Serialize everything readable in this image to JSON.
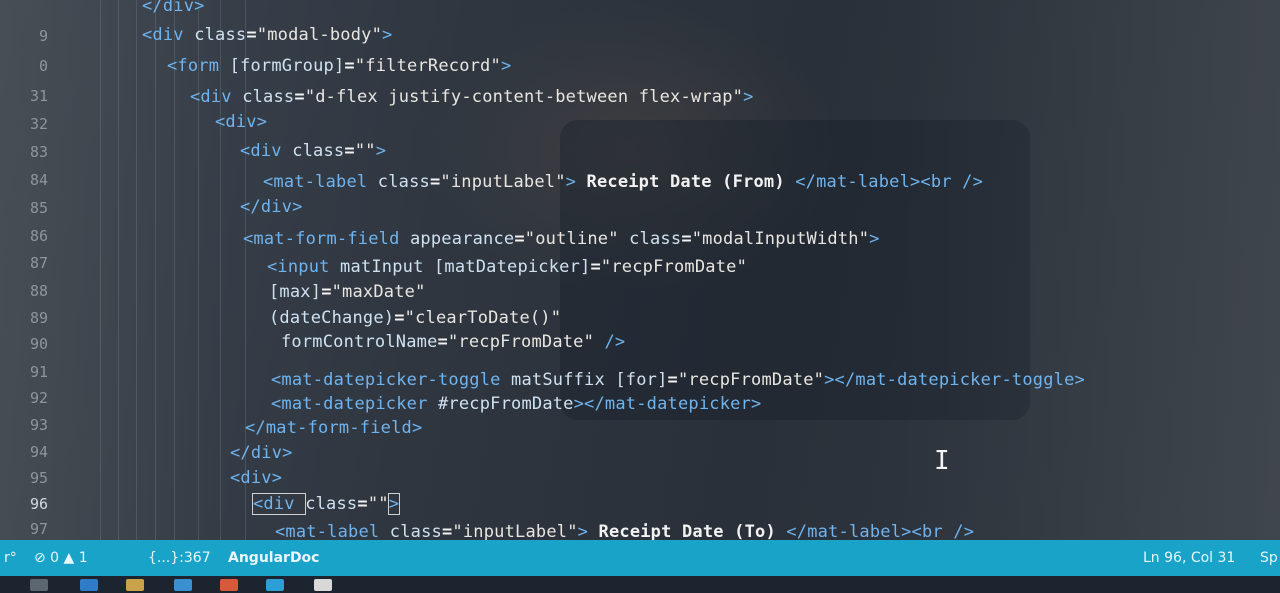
{
  "editor": {
    "lines": [
      {
        "num": "",
        "segs": [
          [
            "t",
            "</div>"
          ]
        ]
      },
      {
        "num": "9",
        "segs": [
          [
            "t",
            "<div "
          ],
          [
            "a",
            "class"
          ],
          [
            "x",
            "="
          ],
          [
            "s",
            "\"modal-body\""
          ],
          [
            "t",
            ">"
          ]
        ]
      },
      {
        "num": "0",
        "segs": [
          [
            "t",
            "<form "
          ],
          [
            "a",
            "[formGroup]"
          ],
          [
            "x",
            "="
          ],
          [
            "s",
            "\"filterRecord\""
          ],
          [
            "t",
            ">"
          ]
        ]
      },
      {
        "num": "31",
        "segs": [
          [
            "t",
            "<div "
          ],
          [
            "a",
            "class"
          ],
          [
            "x",
            "="
          ],
          [
            "s",
            "\"d-flex justify-content-between flex-wrap\""
          ],
          [
            "t",
            ">"
          ]
        ]
      },
      {
        "num": "32",
        "segs": [
          [
            "t",
            "<div>"
          ]
        ]
      },
      {
        "num": "83",
        "segs": [
          [
            "t",
            "<div "
          ],
          [
            "a",
            "class"
          ],
          [
            "x",
            "="
          ],
          [
            "s",
            "\"\""
          ],
          [
            "t",
            ">"
          ]
        ]
      },
      {
        "num": "84",
        "segs": [
          [
            "t",
            "<mat-label "
          ],
          [
            "a",
            "class"
          ],
          [
            "x",
            "="
          ],
          [
            "s",
            "\"inputLabel\""
          ],
          [
            "t",
            ">"
          ],
          [
            "x",
            " Receipt Date (From) "
          ],
          [
            "t",
            "</mat-label><br />"
          ]
        ]
      },
      {
        "num": "85",
        "segs": [
          [
            "t",
            "</div>"
          ]
        ]
      },
      {
        "num": "86",
        "segs": [
          [
            "t",
            "<mat-form-field "
          ],
          [
            "a",
            "appearance"
          ],
          [
            "x",
            "="
          ],
          [
            "s",
            "\"outline\" "
          ],
          [
            "a",
            "class"
          ],
          [
            "x",
            "="
          ],
          [
            "s",
            "\"modalInputWidth\""
          ],
          [
            "t",
            ">"
          ]
        ]
      },
      {
        "num": "87",
        "segs": [
          [
            "t",
            "<input "
          ],
          [
            "a",
            "matInput [matDatepicker]"
          ],
          [
            "x",
            "="
          ],
          [
            "s",
            "\"recpFromDate\""
          ]
        ]
      },
      {
        "num": "88",
        "segs": [
          [
            "a",
            "[max]"
          ],
          [
            "x",
            "="
          ],
          [
            "s",
            "\"maxDate\""
          ]
        ]
      },
      {
        "num": "89",
        "segs": [
          [
            "a",
            "(dateChange)"
          ],
          [
            "x",
            "="
          ],
          [
            "s",
            "\"clearToDate()\""
          ]
        ]
      },
      {
        "num": "90",
        "segs": [
          [
            "a",
            "formControlName"
          ],
          [
            "x",
            "="
          ],
          [
            "s",
            "\"recpFromDate\" "
          ],
          [
            "t",
            "/>"
          ]
        ]
      },
      {
        "num": "91",
        "segs": [
          [
            "t",
            "<mat-datepicker-toggle "
          ],
          [
            "a",
            "matSuffix [for]"
          ],
          [
            "x",
            "="
          ],
          [
            "s",
            "\"recpFromDate\""
          ],
          [
            "t",
            "></mat-datepicker-toggle>"
          ]
        ]
      },
      {
        "num": "92",
        "segs": [
          [
            "t",
            "<mat-datepicker "
          ],
          [
            "a",
            "#recpFromDate"
          ],
          [
            "t",
            "></mat-datepicker>"
          ]
        ]
      },
      {
        "num": "93",
        "segs": [
          [
            "t",
            "</mat-form-field>"
          ]
        ]
      },
      {
        "num": "94",
        "segs": [
          [
            "t",
            "</div>"
          ]
        ]
      },
      {
        "num": "95",
        "segs": [
          [
            "t",
            "<div>"
          ]
        ]
      },
      {
        "num": "96",
        "segs": [
          [
            "t",
            "<div "
          ],
          [
            "a",
            "class"
          ],
          [
            "x",
            "="
          ],
          [
            "s",
            "\"\""
          ],
          [
            "t",
            ">"
          ]
        ]
      },
      {
        "num": "97",
        "segs": [
          [
            "t",
            "<mat-label "
          ],
          [
            "a",
            "class"
          ],
          [
            "x",
            "="
          ],
          [
            "s",
            "\"inputLabel\""
          ],
          [
            "t",
            ">"
          ],
          [
            "x",
            " Receipt Date (To) "
          ],
          [
            "t",
            "</mat-label><br />"
          ]
        ]
      }
    ]
  },
  "statusbar": {
    "icons_text": "⊘ 0 ▲ 1",
    "bracket_info": "{...}:367",
    "language": "AngularDoc",
    "cursor": "Ln 96, Col 31",
    "trailing": "Sp"
  },
  "colors": {
    "statusbar": "#1aa3c9",
    "tag": "#6fb4ef",
    "background": "#2f3640"
  }
}
